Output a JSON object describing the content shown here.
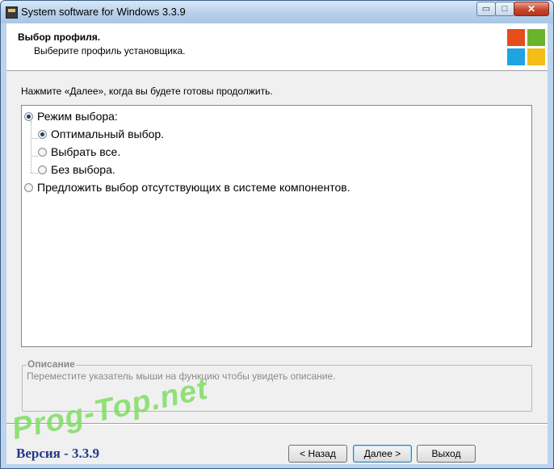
{
  "window": {
    "title": "System software for Windows 3.3.9",
    "controls": {
      "minimize": "▭",
      "maximize": "□",
      "close": "✕"
    }
  },
  "header": {
    "title": "Выбор профиля.",
    "subtitle": "Выберите профиль установщика.",
    "logo_colors": [
      "#e74c1c",
      "#6ab42d",
      "#1ea4e0",
      "#f5bd18"
    ]
  },
  "instruction": "Нажмите «Далее», когда вы будете готовы продолжить.",
  "options": {
    "mode": {
      "label": "Режим выбора:",
      "checked": true
    },
    "sub": [
      {
        "label": "Оптимальный выбор.",
        "checked": true
      },
      {
        "label": "Выбрать все.",
        "checked": false
      },
      {
        "label": "Без выбора.",
        "checked": false
      }
    ],
    "suggest": {
      "label": "Предложить выбор отсутствующих в системе компонентов.",
      "checked": false
    }
  },
  "description": {
    "legend": "Описание",
    "text": "Переместите указатель мыши на функцию чтобы увидеть описание."
  },
  "watermark": "Prog-Top.net",
  "version": "Версия - 3.3.9",
  "buttons": {
    "back": "< Назад",
    "next": "Далее >",
    "exit": "Выход"
  }
}
